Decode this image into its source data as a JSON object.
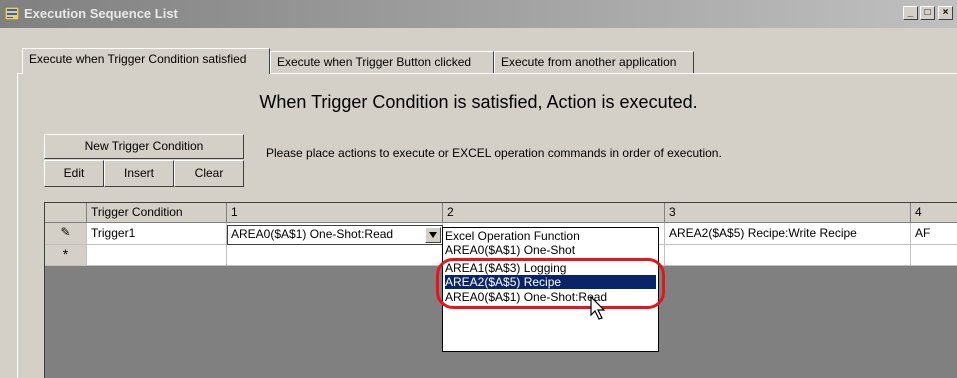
{
  "window": {
    "title": "Execution Sequence List",
    "controls": {
      "minimize": "_",
      "maximize": "□",
      "close": "×"
    }
  },
  "tabs": [
    {
      "label": "Execute when Trigger Condition satisfied",
      "active": true
    },
    {
      "label": "Execute when Trigger Button clicked",
      "active": false
    },
    {
      "label": "Execute from another application",
      "active": false
    }
  ],
  "heading": "When Trigger Condition is satisfied, Action is executed.",
  "buttons": {
    "new_trigger": "New Trigger Condition",
    "edit": "Edit",
    "insert": "Insert",
    "clear": "Clear"
  },
  "hint": "Please place actions to execute or EXCEL operation commands in order of execution.",
  "grid": {
    "columns": [
      "",
      "Trigger Condition",
      "1",
      "2",
      "3",
      "4"
    ],
    "row1": {
      "marker": "✎",
      "trigger": "Trigger1",
      "col1": "AREA0($A$1) One-Shot:Read",
      "col3": "AREA2($A$5) Recipe:Write Recipe",
      "col4": "AF"
    },
    "new_row_marker": "*"
  },
  "dropdown": {
    "items": [
      {
        "label": "Excel Operation Function",
        "selected": false
      },
      {
        "label": "AREA0($A$1) One-Shot",
        "selected": false
      },
      {
        "label": "AREA1($A$3) Logging",
        "selected": false
      },
      {
        "label": "AREA2($A$5) Recipe",
        "selected": true
      },
      {
        "label": "AREA0($A$1) One-Shot:Read",
        "selected": false
      }
    ]
  },
  "colors": {
    "selection": "#0a246a",
    "highlight_ring": "#e8141c",
    "face": "#d4d0c8"
  }
}
